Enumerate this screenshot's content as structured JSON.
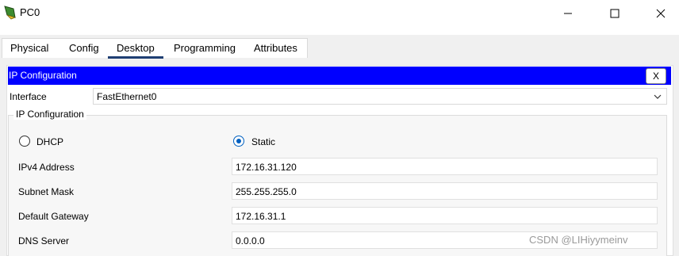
{
  "window": {
    "title": "PC0"
  },
  "tabs": [
    {
      "label": "Physical",
      "active": false
    },
    {
      "label": "Config",
      "active": false
    },
    {
      "label": "Desktop",
      "active": true
    },
    {
      "label": "Programming",
      "active": false
    },
    {
      "label": "Attributes",
      "active": false
    }
  ],
  "ip_panel": {
    "title": "IP Configuration",
    "close_label": "X",
    "interface_label": "Interface",
    "interface_value": "FastEthernet0",
    "group_title": "IP Configuration",
    "mode": {
      "dhcp_label": "DHCP",
      "static_label": "Static",
      "selected": "Static"
    },
    "fields": [
      {
        "label": "IPv4 Address",
        "value": "172.16.31.120"
      },
      {
        "label": "Subnet Mask",
        "value": "255.255.255.0"
      },
      {
        "label": "Default Gateway",
        "value": "172.16.31.1"
      },
      {
        "label": "DNS Server",
        "value": "0.0.0.0"
      }
    ]
  },
  "watermark": "CSDN @LIHiyymeinv",
  "colors": {
    "header_bar": "#0000ff",
    "radio_selected": "#0060c0",
    "active_tab_underline": "#1f3f73"
  }
}
